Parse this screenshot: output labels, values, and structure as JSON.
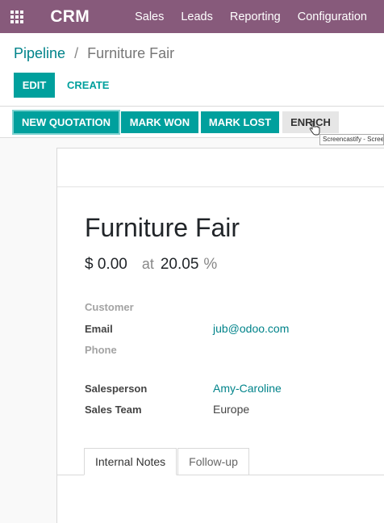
{
  "navbar": {
    "app_name": "CRM",
    "apps_icon": "apps-grid-icon",
    "menu": [
      {
        "label": "Sales"
      },
      {
        "label": "Leads"
      },
      {
        "label": "Reporting"
      },
      {
        "label": "Configuration"
      }
    ],
    "color": "#875a7b"
  },
  "breadcrumb": {
    "parent": "Pipeline",
    "separator": "/",
    "current": "Furniture Fair"
  },
  "actions": {
    "edit": "EDIT",
    "create": "CREATE"
  },
  "statusbar": {
    "buttons": [
      {
        "label": "NEW QUOTATION"
      },
      {
        "label": "MARK WON"
      },
      {
        "label": "MARK LOST"
      },
      {
        "label": "ENRICH"
      }
    ]
  },
  "tooltip": "Screencastify - Screen",
  "record": {
    "name": "Furniture Fair",
    "revenue": "$ 0.00",
    "at": "at",
    "probability": "20.05",
    "percent": "%"
  },
  "fields": {
    "customer": {
      "label": "Customer",
      "value": ""
    },
    "email": {
      "label": "Email",
      "value": "jub@odoo.com"
    },
    "phone": {
      "label": "Phone",
      "value": ""
    },
    "salesperson": {
      "label": "Salesperson",
      "value": "Amy-Caroline"
    },
    "sales_team": {
      "label": "Sales Team",
      "value": "Europe"
    }
  },
  "tabs": [
    {
      "label": "Internal Notes"
    },
    {
      "label": "Follow-up"
    }
  ],
  "colors": {
    "accent": "#00a09d",
    "link": "#00838a"
  }
}
